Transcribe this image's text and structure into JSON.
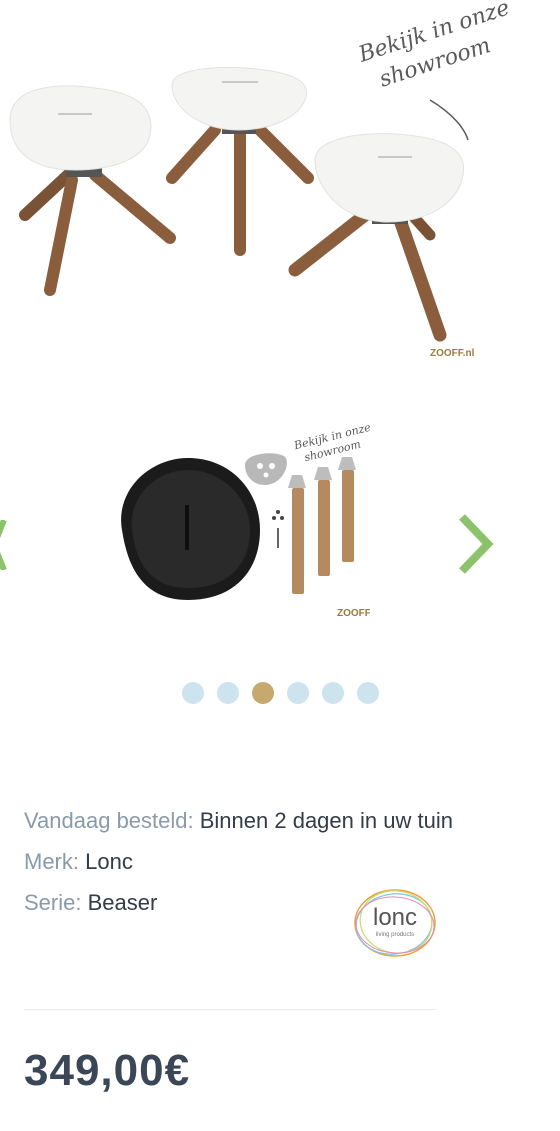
{
  "hero": {
    "overlay_text_line1": "Bekijk in onze",
    "overlay_text_line2": "showroom",
    "watermark": "ZOOFF.nl"
  },
  "slide": {
    "overlay_text_line1": "Bekijk in onze",
    "overlay_text_line2": "showroom",
    "watermark": "ZOOFF.nl"
  },
  "carousel": {
    "dot_count": 6,
    "active_index": 2,
    "colors": {
      "dot": "#cde3ee",
      "active_dot": "#c5a96e",
      "next_arrow": "#8cc26a"
    }
  },
  "details": {
    "order_label": "Vandaag besteld:",
    "order_value": "Binnen 2 dagen in uw tuin",
    "brand_label": "Merk:",
    "brand_value": "Lonc",
    "series_label": "Serie:",
    "series_value": "Beaser"
  },
  "brand_logo": {
    "name": "lonc",
    "tagline": "living products"
  },
  "price": "349,00€"
}
